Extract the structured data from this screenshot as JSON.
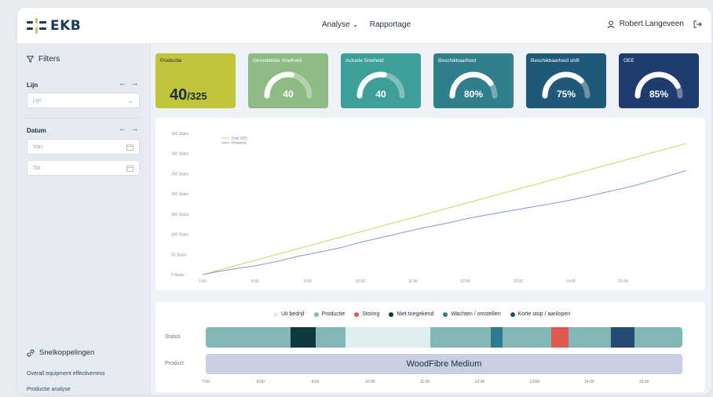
{
  "header": {
    "logo_text": "EKB",
    "nav": [
      "Analyse",
      "Rapportage"
    ],
    "analyse_chevron": "chevron-down-icon",
    "user_name": "Robert Langeveen",
    "user_icon": "user-icon",
    "logout_icon": "logout-icon"
  },
  "sidebar": {
    "filters_title": "Filters",
    "line_label": "Lijn",
    "line_placeholder": "Lijn",
    "date_label": "Datum",
    "from_placeholder": "Van",
    "to_placeholder": "Tot",
    "quick_title": "Snelkoppelingen",
    "quick_links": [
      "Overall equipment effectiveness",
      "Productie analyse"
    ]
  },
  "cards": [
    {
      "title": "Productie",
      "value": "40",
      "suffix": "/325",
      "color": "#bfc43a"
    },
    {
      "title": "Gemiddelde Snelheid",
      "value": "40",
      "gauge_fraction": 0.55,
      "color": "#8dbb83"
    },
    {
      "title": "Actuele Snelheid",
      "value": "40",
      "gauge_fraction": 0.55,
      "color": "#3e9e98"
    },
    {
      "title": "Beschikbaarheid",
      "value": "80%",
      "gauge_fraction": 0.8,
      "color": "#2f7f8c"
    },
    {
      "title": "Beschikbaarheid shift",
      "value": "75%",
      "gauge_fraction": 0.75,
      "color": "#1f5878"
    },
    {
      "title": "OEE",
      "value": "85%",
      "gauge_fraction": 0.85,
      "color": "#1e3d6e"
    }
  ],
  "chart_data": {
    "type": "line",
    "x_ticks": [
      "7:00",
      "8:00",
      "9:00",
      "10:00",
      "11:00",
      "12:00",
      "13:00",
      "14:00",
      "15:00"
    ],
    "y_ticks": [
      "0 Stuks",
      "50 Stuks",
      "100 Stuks",
      "150 Stuks",
      "200 Stuks",
      "250 Stuks",
      "300 Stuks",
      "350 Stuks"
    ],
    "ylim": [
      0,
      350
    ],
    "xlim": [
      7.0,
      16.2
    ],
    "series": [
      {
        "name": "Doel OEE",
        "color": "#d1d66a",
        "x": [
          7.0,
          16.2
        ],
        "y": [
          0,
          325
        ]
      },
      {
        "name": "Productie",
        "color": "#8aa0d2",
        "x": [
          7.0,
          7.3,
          7.6,
          8.0,
          8.4,
          8.8,
          9.2,
          9.6,
          10.0,
          10.4,
          10.8,
          11.2,
          11.6,
          12.0,
          12.4,
          12.8,
          13.2,
          13.6,
          14.0,
          14.4,
          14.8,
          15.2,
          15.6,
          16.0,
          16.2
        ],
        "y": [
          0,
          8,
          14,
          22,
          32,
          45,
          55,
          66,
          80,
          92,
          104,
          116,
          126,
          138,
          148,
          157,
          166,
          175,
          185,
          196,
          208,
          220,
          235,
          250,
          258
        ]
      }
    ]
  },
  "timeline": {
    "legend": [
      {
        "label": "Uit bedrijf",
        "color": "#dfeff0"
      },
      {
        "label": "Productie",
        "color": "#83b7b6"
      },
      {
        "label": "Storing",
        "color": "#e0584f"
      },
      {
        "label": "Niet toegekend",
        "color": "#0f3a3d"
      },
      {
        "label": "Wachten / omstellen",
        "color": "#2e7a92"
      },
      {
        "label": "Korte stop / aanlopen",
        "color": "#254a74"
      }
    ],
    "status_label": "Status",
    "product_label": "Product",
    "product_name": "WoodFibre Medium",
    "segments": [
      {
        "start": 7.0,
        "end": 8.55,
        "state": 1
      },
      {
        "start": 8.55,
        "end": 9.0,
        "state": 3
      },
      {
        "start": 9.0,
        "end": 9.55,
        "state": 1
      },
      {
        "start": 9.55,
        "end": 11.1,
        "state": 0
      },
      {
        "start": 11.1,
        "end": 12.2,
        "state": 1
      },
      {
        "start": 12.2,
        "end": 12.42,
        "state": 4
      },
      {
        "start": 12.42,
        "end": 13.3,
        "state": 1
      },
      {
        "start": 13.3,
        "end": 13.62,
        "state": 2
      },
      {
        "start": 13.62,
        "end": 14.4,
        "state": 1
      },
      {
        "start": 14.4,
        "end": 14.83,
        "state": 5
      },
      {
        "start": 14.83,
        "end": 15.7,
        "state": 1
      }
    ],
    "range": [
      7.0,
      15.7
    ],
    "ticks": [
      "7:00",
      "8:00",
      "9:00",
      "10:00",
      "11:00",
      "12:00",
      "13:00",
      "14:00",
      "15:00"
    ]
  }
}
